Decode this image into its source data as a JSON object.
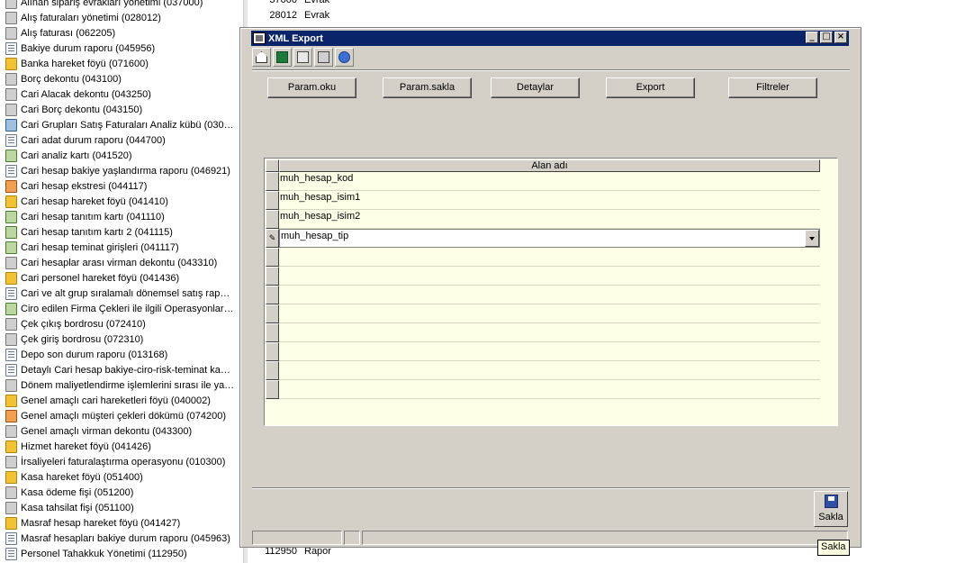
{
  "background_list": [
    {
      "label": "Alınan sipariş evrakları yönetimi (037000)",
      "icon": "bundle"
    },
    {
      "label": "Alış faturaları yönetimi (028012)",
      "icon": "bundle"
    },
    {
      "label": "Alış faturası (062205)",
      "icon": "bundle"
    },
    {
      "label": "Bakiye durum raporu (045956)",
      "icon": "doc"
    },
    {
      "label": "Banka hareket föyü (071600)",
      "icon": "folder"
    },
    {
      "label": "Borç dekontu (043100)",
      "icon": "bundle"
    },
    {
      "label": "Cari Alacak dekontu (043250)",
      "icon": "bundle"
    },
    {
      "label": "Cari Borç dekontu (043150)",
      "icon": "bundle"
    },
    {
      "label": "Cari Grupları Satış Faturaları Analiz kübü (030…",
      "icon": "cube"
    },
    {
      "label": "Cari adat durum raporu (044700)",
      "icon": "doc"
    },
    {
      "label": "Cari analiz kartı (041520)",
      "icon": "form"
    },
    {
      "label": "Cari hesap bakiye yaşlandırma raporu (046921)",
      "icon": "doc"
    },
    {
      "label": "Cari hesap ekstresi (044117)",
      "icon": "orange"
    },
    {
      "label": "Cari hesap hareket föyü (041410)",
      "icon": "folder"
    },
    {
      "label": "Cari hesap tanıtım kartı (041110)",
      "icon": "form"
    },
    {
      "label": "Cari hesap tanıtım kartı 2 (041115)",
      "icon": "form"
    },
    {
      "label": "Cari hesap teminat girişleri (041117)",
      "icon": "form"
    },
    {
      "label": "Cari hesaplar arası virman dekontu (043310)",
      "icon": "bundle"
    },
    {
      "label": "Cari personel hareket föyü (041436)",
      "icon": "folder"
    },
    {
      "label": "Cari ve alt grup sıralamalı dönemsel satış rap…",
      "icon": "doc"
    },
    {
      "label": "Ciro edilen Firma Çekleri ile ilgili Operasyonlar…",
      "icon": "form"
    },
    {
      "label": "Çek çıkış bordrosu (072410)",
      "icon": "bundle"
    },
    {
      "label": "Çek giriş bordrosu (072310)",
      "icon": "bundle"
    },
    {
      "label": "Depo son durum raporu (013168)",
      "icon": "doc"
    },
    {
      "label": "Detaylı Cari hesap bakiye-ciro-risk-teminat ka…",
      "icon": "doc"
    },
    {
      "label": "Dönem maliyetlendirme işlemlerini sırası ile ya…",
      "icon": "bundle"
    },
    {
      "label": "Genel amaçlı cari hareketleri föyü (040002)",
      "icon": "folder"
    },
    {
      "label": "Genel amaçlı müşteri çekleri dökümü (074200)",
      "icon": "orange"
    },
    {
      "label": "Genel amaçlı virman dekontu (043300)",
      "icon": "bundle"
    },
    {
      "label": "Hizmet hareket föyü (041426)",
      "icon": "folder"
    },
    {
      "label": "İrsaliyeleri faturalaştırma operasyonu (010300)",
      "icon": "bundle"
    },
    {
      "label": "Kasa hareket föyü (051400)",
      "icon": "folder"
    },
    {
      "label": "Kasa ödeme fişi (051200)",
      "icon": "bundle"
    },
    {
      "label": "Kasa tahsilat fişi (051100)",
      "icon": "bundle"
    },
    {
      "label": "Masraf hesap hareket föyü (041427)",
      "icon": "folder"
    },
    {
      "label": "Masraf hesapları bakiye durum raporu (045963)",
      "icon": "doc"
    },
    {
      "label": "Personel Tahakkuk Yönetimi (112950)",
      "icon": "doc"
    }
  ],
  "background_right": {
    "row1": {
      "num": "37000",
      "type": "Evrak"
    },
    "row2": {
      "num": "28012",
      "type": "Evrak"
    },
    "row3": {
      "num": "112950",
      "type": "Rapor"
    }
  },
  "dialog": {
    "title": "XML Export",
    "window_buttons": {
      "min": "_",
      "max": "□",
      "close": "×"
    },
    "toolbar": [
      "home-icon",
      "excel-icon",
      "edit-icon",
      "calculator-icon",
      "help-icon"
    ],
    "buttons": {
      "param_oku": "Param.oku",
      "param_sakla": "Param.sakla",
      "detaylar": "Detaylar",
      "export": "Export",
      "filtreler": "Filtreler"
    },
    "grid": {
      "column_header": "Alan adı",
      "rows": [
        "muh_hesap_kod",
        "muh_hesap_isim1",
        "muh_hesap_isim2",
        "muh_hesap_tip",
        "",
        "",
        "",
        "",
        "",
        "",
        "",
        ""
      ],
      "active_row_index": 3,
      "active_indicator": "✎"
    },
    "save_label": "Sakla",
    "tooltip": "Sakla"
  }
}
